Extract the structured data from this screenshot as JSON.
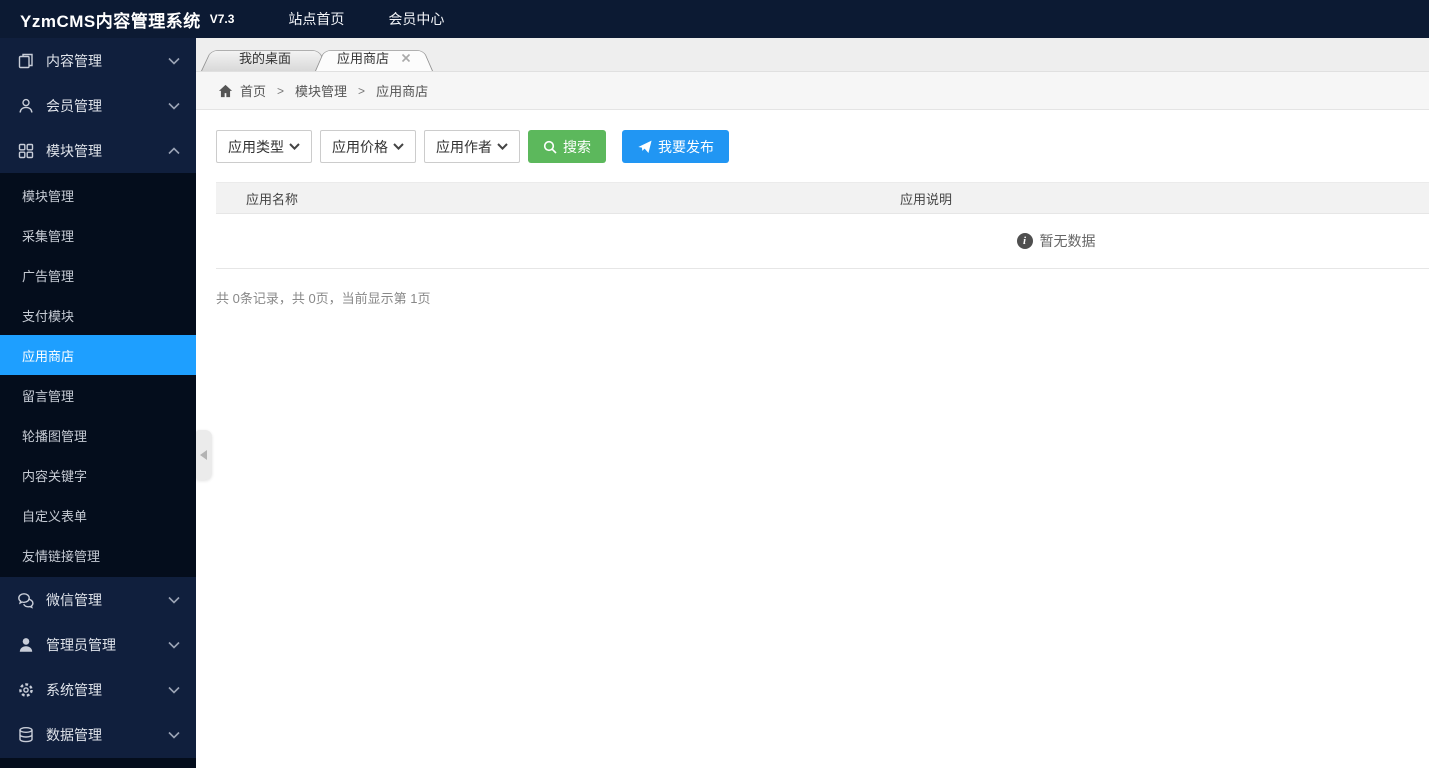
{
  "topbar": {
    "brand": "YzmCMS内容管理系统",
    "version": "V7.3",
    "links": [
      {
        "label": "站点首页"
      },
      {
        "label": "会员中心"
      }
    ]
  },
  "sidebar": {
    "groups": [
      {
        "label": "内容管理",
        "icon": "documents-icon",
        "state": "collapsed"
      },
      {
        "label": "会员管理",
        "icon": "member-icon",
        "state": "collapsed"
      },
      {
        "label": "模块管理",
        "icon": "modules-grid-icon",
        "state": "expanded"
      },
      {
        "label": "微信管理",
        "icon": "wechat-icon",
        "state": "collapsed"
      },
      {
        "label": "管理员管理",
        "icon": "admin-user-icon",
        "state": "collapsed"
      },
      {
        "label": "系统管理",
        "icon": "gear-icon",
        "state": "collapsed"
      },
      {
        "label": "数据管理",
        "icon": "database-icon",
        "state": "collapsed"
      }
    ],
    "module_submenu": [
      {
        "label": "模块管理",
        "active": false
      },
      {
        "label": "采集管理",
        "active": false
      },
      {
        "label": "广告管理",
        "active": false
      },
      {
        "label": "支付模块",
        "active": false
      },
      {
        "label": "应用商店",
        "active": true
      },
      {
        "label": "留言管理",
        "active": false
      },
      {
        "label": "轮播图管理",
        "active": false
      },
      {
        "label": "内容关键字",
        "active": false
      },
      {
        "label": "自定义表单",
        "active": false
      },
      {
        "label": "友情链接管理",
        "active": false
      }
    ]
  },
  "tabs": [
    {
      "label": "我的桌面",
      "active": false,
      "closable": false
    },
    {
      "label": "应用商店",
      "active": true,
      "closable": true
    }
  ],
  "breadcrumb": {
    "separator": ">",
    "items": [
      "首页",
      "模块管理",
      "应用商店"
    ]
  },
  "filters": {
    "selects": [
      {
        "value": "应用类型"
      },
      {
        "value": "应用价格"
      },
      {
        "value": "应用作者"
      }
    ],
    "search_label": "搜索",
    "publish_label": "我要发布"
  },
  "table": {
    "columns": [
      "应用名称",
      "应用说明"
    ],
    "empty_text": "暂无数据"
  },
  "pagination": {
    "summary": "共 0条记录，共 0页，当前显示第 1页"
  },
  "colors": {
    "topbar_bg": "#0c1a33",
    "sidebar_bg": "#101f3d",
    "submenu_bg": "#040d1c",
    "active_blue": "#1E9FFF",
    "search_green": "#5cb85c",
    "publish_blue": "#2196f3"
  }
}
